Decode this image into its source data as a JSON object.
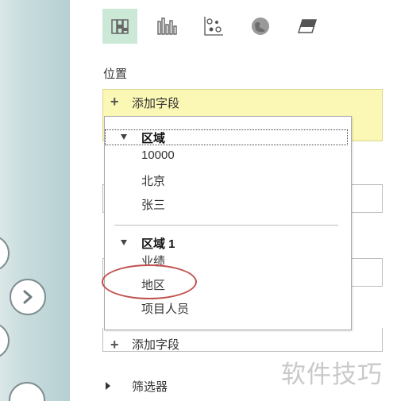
{
  "toolbar": {
    "tools": [
      {
        "icon": "field-list-icon",
        "active": true
      },
      {
        "icon": "bar-chart-icon",
        "active": false
      },
      {
        "icon": "bubble-chart-icon",
        "active": false
      },
      {
        "icon": "map-icon",
        "active": false
      },
      {
        "icon": "eraser-icon",
        "active": false
      }
    ]
  },
  "section": {
    "position_label": "位置"
  },
  "add_field": {
    "label": "添加字段",
    "label_bottom": "添加字段"
  },
  "dropdown": {
    "groups": [
      {
        "title": "区域",
        "items": [
          "10000",
          "北京",
          "张三"
        ]
      },
      {
        "title": "区域 1",
        "items": [
          "业绩",
          "地区",
          "项目人员"
        ]
      }
    ],
    "highlighted_item": "地区"
  },
  "filter": {
    "label": "筛选器"
  },
  "watermark": "软件技巧",
  "colors": {
    "active_tool": "#cce8d7",
    "add_field_bg": "#fbf7b4",
    "highlight": "#c0504d"
  }
}
